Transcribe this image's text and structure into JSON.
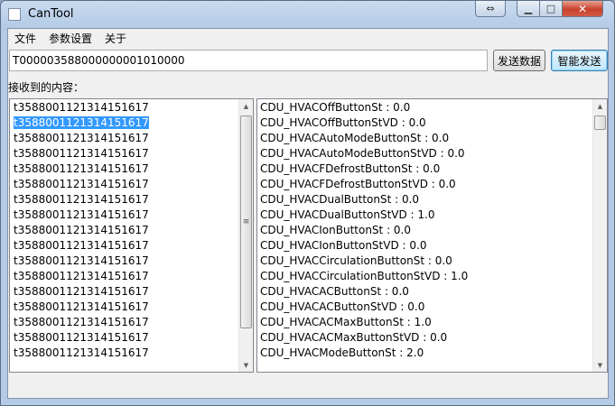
{
  "window": {
    "title": "CanTool"
  },
  "titlebar_buttons": {
    "restore_glyph": "⇔",
    "min_glyph": "▁",
    "max_glyph": "□",
    "close_glyph": "✕"
  },
  "menu": [
    "文件",
    "参数设置",
    "关于"
  ],
  "command_input": {
    "value": "T000003588000000001010000"
  },
  "buttons": {
    "send": "发送数据",
    "smart_send": "智能发送"
  },
  "received_label": "接收到的内容：",
  "left_list": {
    "selected_index": 1,
    "items": [
      "t3588001121314151617",
      "t3588001121314151617",
      "t3588001121314151617",
      "t3588001121314151617",
      "t3588001121314151617",
      "t3588001121314151617",
      "t3588001121314151617",
      "t3588001121314151617",
      "t3588001121314151617",
      "t3588001121314151617",
      "t3588001121314151617",
      "t3588001121314151617",
      "t3588001121314151617",
      "t3588001121314151617",
      "t3588001121314151617",
      "t3588001121314151617",
      "t3588001121314151617"
    ]
  },
  "right_list": {
    "items": [
      "CDU_HVACOffButtonSt : 0.0",
      "CDU_HVACOffButtonStVD : 0.0",
      "CDU_HVACAutoModeButtonSt : 0.0",
      "CDU_HVACAutoModeButtonStVD : 0.0",
      "CDU_HVACFDefrostButtonSt : 0.0",
      "CDU_HVACFDefrostButtonStVD : 0.0",
      "CDU_HVACDualButtonSt : 0.0",
      "CDU_HVACDualButtonStVD : 1.0",
      "CDU_HVACIonButtonSt : 0.0",
      "CDU_HVACIonButtonStVD : 0.0",
      "CDU_HVACCirculationButtonSt : 0.0",
      "CDU_HVACCirculationButtonStVD : 1.0",
      "CDU_HVACACButtonSt : 0.0",
      "CDU_HVACACButtonStVD : 0.0",
      "CDU_HVACACMaxButtonSt : 1.0",
      "CDU_HVACACMaxButtonStVD : 0.0",
      "CDU_HVACModeButtonSt : 2.0"
    ]
  },
  "scrollbars": {
    "up_glyph": "▲",
    "down_glyph": "▼",
    "grip_glyph": "≡"
  }
}
